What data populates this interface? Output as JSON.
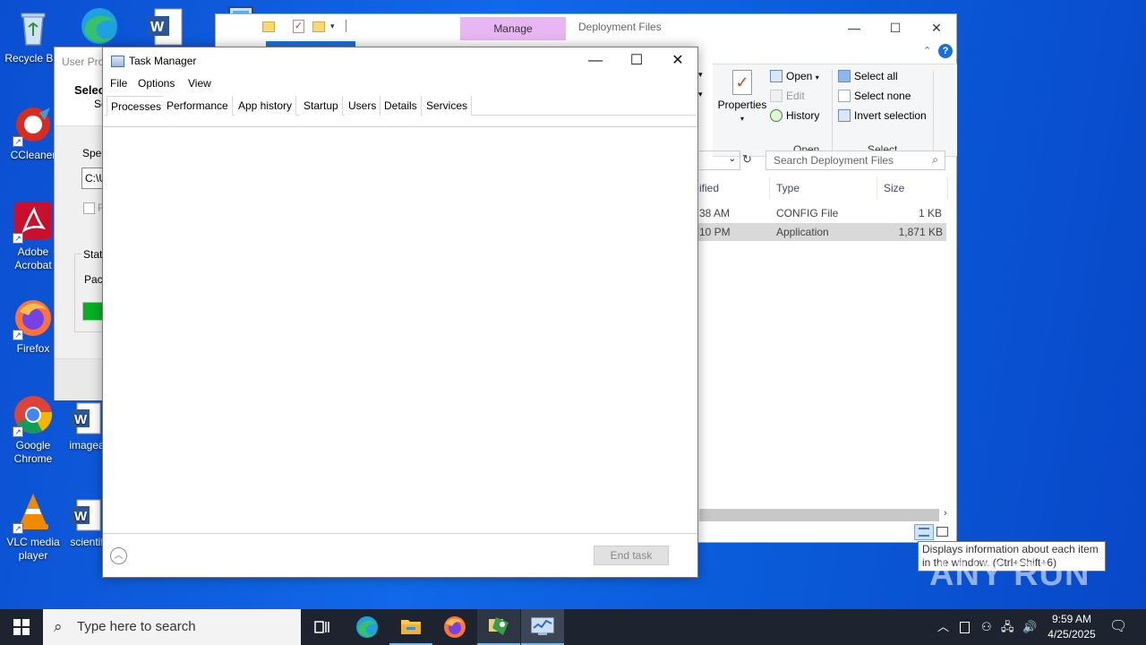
{
  "desktop": {
    "icons": [
      {
        "label": "Recycle Bin"
      },
      {
        "label": "CCleaner"
      },
      {
        "label": "Adobe Acrobat"
      },
      {
        "label": "Firefox"
      },
      {
        "label": "Google Chrome"
      },
      {
        "label": "VLC media player"
      },
      {
        "label": "imagea"
      },
      {
        "label": "scientif"
      }
    ]
  },
  "user_profile": {
    "title": "User Prof",
    "heading": "Selec",
    "sub": "Se",
    "spec_label": "Spec",
    "path_value": "C:\\U",
    "checkbox_label": "F",
    "status_label": "Statu",
    "pack_label": "Pack"
  },
  "explorer": {
    "manage_tab": "Manage",
    "window_title": "Deployment Files",
    "ribbon": {
      "properties": "Properties",
      "open": "Open",
      "edit": "Edit",
      "history": "History",
      "select_all": "Select all",
      "select_none": "Select none",
      "invert_selection": "Invert selection",
      "group_open": "Open",
      "group_select": "Select"
    },
    "search_placeholder": "Search Deployment Files",
    "columns": {
      "modified": "ified",
      "type": "Type",
      "size": "Size"
    },
    "rows": [
      {
        "modified": "38 AM",
        "type": "CONFIG File",
        "size": "1 KB"
      },
      {
        "modified": "10 PM",
        "type": "Application",
        "size": "1,871 KB"
      }
    ],
    "tooltip": "Displays information about each item in the window. (Ctrl+Shift+6)"
  },
  "taskmgr": {
    "title": "Task Manager",
    "menu": [
      "File",
      "Options",
      "View"
    ],
    "tabs": [
      "Processes",
      "Performance",
      "App history",
      "Startup",
      "Users",
      "Details",
      "Services"
    ],
    "end_task": "End task"
  },
  "taskbar": {
    "search_placeholder": "Type here to search",
    "time": "9:59 AM",
    "date": "4/25/2025"
  },
  "watermark": "ANY RUN"
}
